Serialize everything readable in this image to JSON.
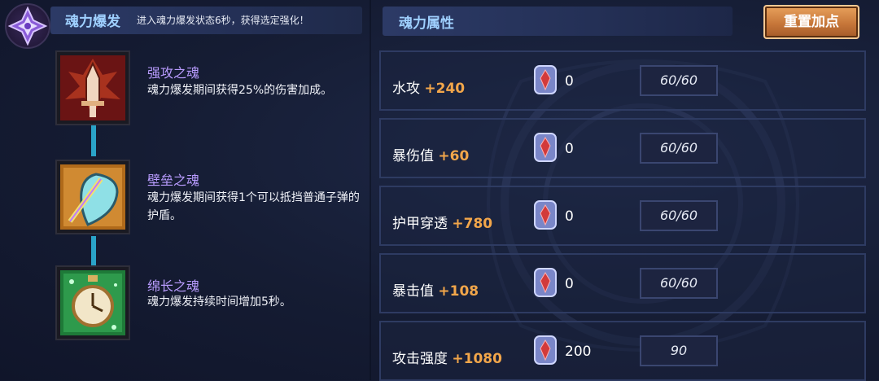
{
  "header": {
    "burst_title": "魂力爆发",
    "burst_desc": "进入魂力爆发状态6秒，获得选定强化！",
    "attr_title": "魂力属性",
    "reset_label": "重置加点"
  },
  "talents": [
    {
      "name": "强攻之魂",
      "desc": "魂力爆发期间获得25%的伤害加成。",
      "icon": "sword-icon"
    },
    {
      "name": "壁垒之魂",
      "desc": "魂力爆发期间获得1个可以抵挡普通子弹的护盾。",
      "icon": "shield-icon"
    },
    {
      "name": "绵长之魂",
      "desc": "魂力爆发持续时间增加5秒。",
      "icon": "stopwatch-icon"
    }
  ],
  "attributes": [
    {
      "name": "水攻",
      "bonus": "+240",
      "gems": "0",
      "level": "60/60"
    },
    {
      "name": "暴伤值",
      "bonus": "+60",
      "gems": "0",
      "level": "60/60"
    },
    {
      "name": "护甲穿透",
      "bonus": "+780",
      "gems": "0",
      "level": "60/60"
    },
    {
      "name": "暴击值",
      "bonus": "+108",
      "gems": "0",
      "level": "60/60"
    },
    {
      "name": "攻击强度",
      "bonus": "+1080",
      "gems": "200",
      "level": "90"
    }
  ],
  "colors": {
    "title_blue": "#9fd0ff",
    "talent_purple": "#b99cff",
    "bonus_orange": "#f2a64a",
    "button_orange": "#c7773a",
    "connector_cyan": "#2aa3c8"
  }
}
